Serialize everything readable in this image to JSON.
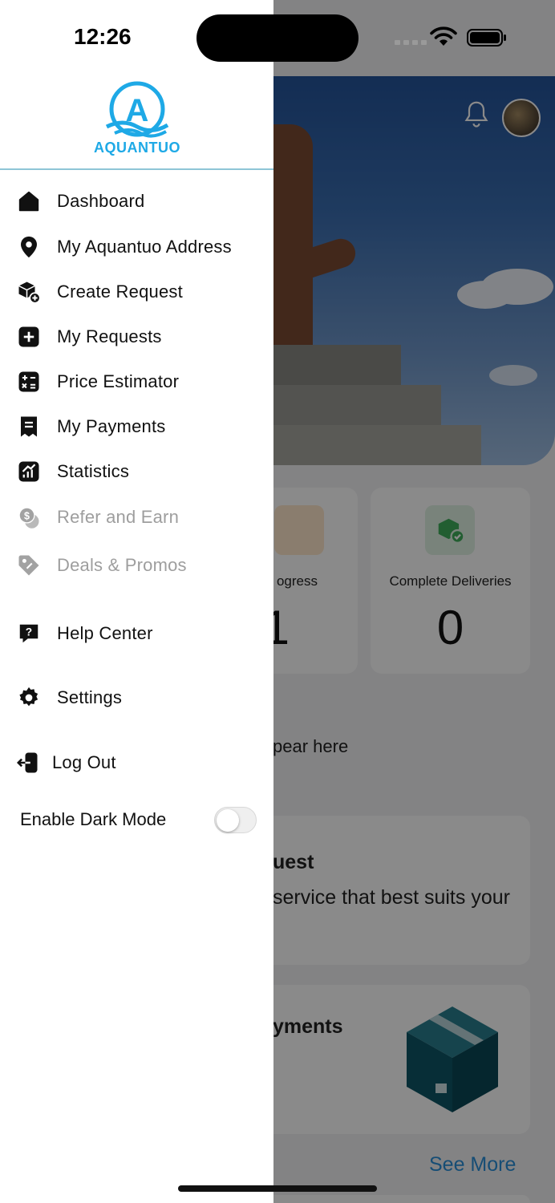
{
  "status_bar": {
    "time": "12:26"
  },
  "drawer": {
    "logo_text": "AQUANTUO",
    "menu": [
      {
        "label": "Dashboard",
        "icon": "home-icon",
        "enabled": true
      },
      {
        "label": "My Aquantuo Address",
        "icon": "location-pin-icon",
        "enabled": true
      },
      {
        "label": "Create Request",
        "icon": "package-add-icon",
        "enabled": true
      },
      {
        "label": "My Requests",
        "icon": "plus-square-icon",
        "enabled": true
      },
      {
        "label": "Price Estimator",
        "icon": "calculator-icon",
        "enabled": true
      },
      {
        "label": "My Payments",
        "icon": "receipt-icon",
        "enabled": true
      },
      {
        "label": "Statistics",
        "icon": "chart-icon",
        "enabled": true
      },
      {
        "label": "Refer and Earn",
        "icon": "coins-icon",
        "enabled": false
      },
      {
        "label": "Deals & Promos",
        "icon": "tag-icon",
        "enabled": false
      },
      {
        "label": "Help Center",
        "icon": "help-chat-icon",
        "enabled": true
      },
      {
        "label": "Settings",
        "icon": "gear-icon",
        "enabled": true
      },
      {
        "label": "Log Out",
        "icon": "logout-icon",
        "enabled": true
      }
    ],
    "dark_mode": {
      "label": "Enable Dark Mode",
      "enabled": false
    }
  },
  "background": {
    "in_progress_label": "ogress",
    "in_progress_value": "1",
    "complete_label": "Complete Deliveries",
    "complete_value": "0",
    "empty_text": "pear here",
    "request_card_title": "uest",
    "request_card_text": "service that best suits your",
    "payments_card_title": "yments",
    "see_more": "See More"
  },
  "colors": {
    "brand": "#1ea9e6",
    "link": "#2a8fd8",
    "disabled": "#9e9e9e"
  }
}
